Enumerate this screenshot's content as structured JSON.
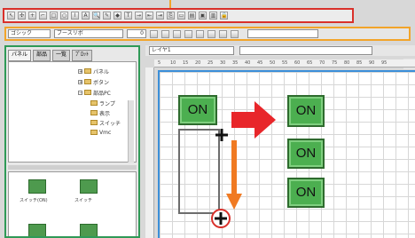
{
  "toolbar1": {
    "icons": [
      "pointer-icon",
      "move-icon",
      "crosshair-icon",
      "line-icon",
      "rectangle-icon",
      "ellipse-icon",
      "polyline-icon",
      "text-icon",
      "zoom-icon",
      "pen-icon",
      "node-icon",
      "label-icon",
      "arrow-icon",
      "align-left-icon",
      "align-right-icon",
      "copy-icon",
      "paste-icon",
      "layer-icon",
      "group-icon",
      "stack-icon",
      "lock-icon"
    ]
  },
  "toolbar2": {
    "font_combo": "ゴシック",
    "style_combo": "ブースリボ",
    "size_value": "0"
  },
  "left_panel": {
    "tabs": [
      "パネル",
      "部品",
      "一覧",
      "ﾌﾟﾛｯﾄ"
    ],
    "tree": [
      {
        "label": "パネル"
      },
      {
        "label": "ボタン"
      },
      {
        "label": "部品PC"
      },
      {
        "label": "ランプ"
      },
      {
        "label": "表示"
      },
      {
        "label": "スイッチ"
      },
      {
        "label": "Vmc"
      }
    ],
    "parts": [
      {
        "caption": "スイッチ(ON)"
      },
      {
        "caption": "スイッチ"
      },
      {
        "caption": ""
      },
      {
        "caption": ""
      }
    ]
  },
  "drawing": {
    "layer_combo": "レイヤ1",
    "ruler_marks": [
      "5",
      "10",
      "15",
      "20",
      "25",
      "30",
      "35",
      "40",
      "45",
      "50",
      "55",
      "60",
      "65",
      "70",
      "75",
      "80",
      "85",
      "90",
      "95"
    ],
    "buttons": [
      {
        "label": "ON"
      },
      {
        "label": "ON"
      },
      {
        "label": "ON"
      },
      {
        "label": "ON"
      }
    ]
  },
  "colors": {
    "toolbar1_frame": "#d9312b",
    "toolbar2_frame": "#f2a42a",
    "panel_frame": "#2f9a57",
    "canvas_frame": "#3b8fd9",
    "button_fill": "#4caf50",
    "copy_arrow": "#e8262a",
    "drag_arrow": "#f07a22"
  }
}
